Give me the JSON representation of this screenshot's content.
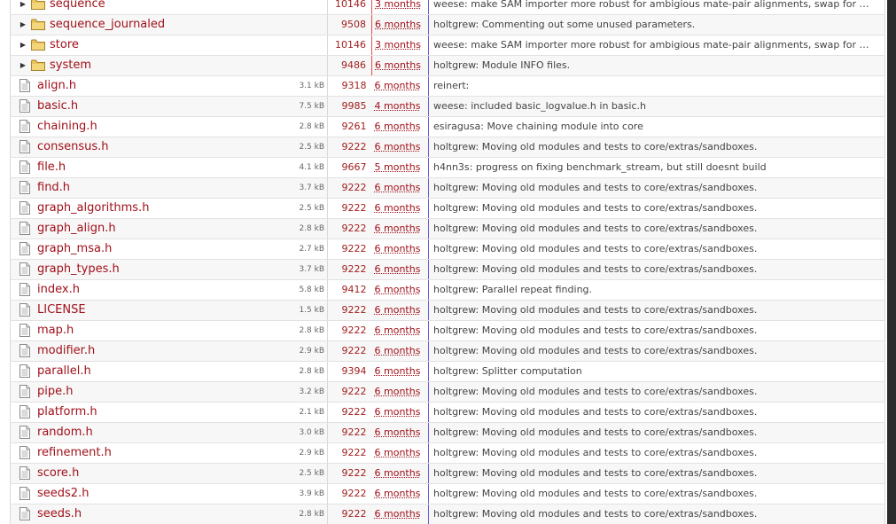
{
  "directories": [
    {
      "name": "sequence",
      "rev": "10146",
      "age": "3 months",
      "msg": "weese: make SAM importer more robust for ambigious mate-pair alignments, swap for …"
    },
    {
      "name": "sequence_journaled",
      "rev": "9508",
      "age": "6 months",
      "msg": "holtgrew: Commenting out some unused parameters."
    },
    {
      "name": "store",
      "rev": "10146",
      "age": "3 months",
      "msg": "weese: make SAM importer more robust for ambigious mate-pair alignments, swap for …"
    },
    {
      "name": "system",
      "rev": "9486",
      "age": "6 months",
      "msg": "holtgrew: Module INFO files."
    }
  ],
  "files": [
    {
      "name": "align.h",
      "size": "3.1 kB",
      "rev": "9318",
      "age": "6 months",
      "msg": "reinert:"
    },
    {
      "name": "basic.h",
      "size": "7.5 kB",
      "rev": "9985",
      "age": "4 months",
      "msg": "weese: included basic_logvalue.h in basic.h"
    },
    {
      "name": "chaining.h",
      "size": "2.8 kB",
      "rev": "9261",
      "age": "6 months",
      "msg": "esiragusa: Move chaining module into core"
    },
    {
      "name": "consensus.h",
      "size": "2.5 kB",
      "rev": "9222",
      "age": "6 months",
      "msg": "holtgrew: Moving old modules and tests to core/extras/sandboxes."
    },
    {
      "name": "file.h",
      "size": "4.1 kB",
      "rev": "9667",
      "age": "5 months",
      "msg": "h4nn3s: progress on fixing benchmark_stream, but still doesnt build"
    },
    {
      "name": "find.h",
      "size": "3.7 kB",
      "rev": "9222",
      "age": "6 months",
      "msg": "holtgrew: Moving old modules and tests to core/extras/sandboxes."
    },
    {
      "name": "graph_algorithms.h",
      "size": "2.5 kB",
      "rev": "9222",
      "age": "6 months",
      "msg": "holtgrew: Moving old modules and tests to core/extras/sandboxes."
    },
    {
      "name": "graph_align.h",
      "size": "2.8 kB",
      "rev": "9222",
      "age": "6 months",
      "msg": "holtgrew: Moving old modules and tests to core/extras/sandboxes."
    },
    {
      "name": "graph_msa.h",
      "size": "2.7 kB",
      "rev": "9222",
      "age": "6 months",
      "msg": "holtgrew: Moving old modules and tests to core/extras/sandboxes."
    },
    {
      "name": "graph_types.h",
      "size": "3.7 kB",
      "rev": "9222",
      "age": "6 months",
      "msg": "holtgrew: Moving old modules and tests to core/extras/sandboxes."
    },
    {
      "name": "index.h",
      "size": "5.8 kB",
      "rev": "9412",
      "age": "6 months",
      "msg": "holtgrew: Parallel repeat finding."
    },
    {
      "name": "LICENSE",
      "size": "1.5 kB",
      "rev": "9222",
      "age": "6 months",
      "msg": "holtgrew: Moving old modules and tests to core/extras/sandboxes."
    },
    {
      "name": "map.h",
      "size": "2.8 kB",
      "rev": "9222",
      "age": "6 months",
      "msg": "holtgrew: Moving old modules and tests to core/extras/sandboxes."
    },
    {
      "name": "modifier.h",
      "size": "2.9 kB",
      "rev": "9222",
      "age": "6 months",
      "msg": "holtgrew: Moving old modules and tests to core/extras/sandboxes."
    },
    {
      "name": "parallel.h",
      "size": "2.8 kB",
      "rev": "9394",
      "age": "6 months",
      "msg": "holtgrew: Splitter computation"
    },
    {
      "name": "pipe.h",
      "size": "3.2 kB",
      "rev": "9222",
      "age": "6 months",
      "msg": "holtgrew: Moving old modules and tests to core/extras/sandboxes."
    },
    {
      "name": "platform.h",
      "size": "2.1 kB",
      "rev": "9222",
      "age": "6 months",
      "msg": "holtgrew: Moving old modules and tests to core/extras/sandboxes."
    },
    {
      "name": "random.h",
      "size": "3.0 kB",
      "rev": "9222",
      "age": "6 months",
      "msg": "holtgrew: Moving old modules and tests to core/extras/sandboxes."
    },
    {
      "name": "refinement.h",
      "size": "2.9 kB",
      "rev": "9222",
      "age": "6 months",
      "msg": "holtgrew: Moving old modules and tests to core/extras/sandboxes."
    },
    {
      "name": "score.h",
      "size": "2.5 kB",
      "rev": "9222",
      "age": "6 months",
      "msg": "holtgrew: Moving old modules and tests to core/extras/sandboxes."
    },
    {
      "name": "seeds2.h",
      "size": "3.9 kB",
      "rev": "9222",
      "age": "6 months",
      "msg": "holtgrew: Moving old modules and tests to core/extras/sandboxes."
    },
    {
      "name": "seeds.h",
      "size": "2.8 kB",
      "rev": "9222",
      "age": "6 months",
      "msg": "holtgrew: Moving old modules and tests to core/extras/sandboxes."
    }
  ],
  "icons": {
    "expander": "triangle-right-icon",
    "folder": "folder-icon",
    "file": "text-file-icon"
  },
  "colors": {
    "link": "#a0101a",
    "folder_fill": "#e8c25a",
    "row_alt": "#f7f7f7",
    "age_divider": "#6b5ed8"
  }
}
